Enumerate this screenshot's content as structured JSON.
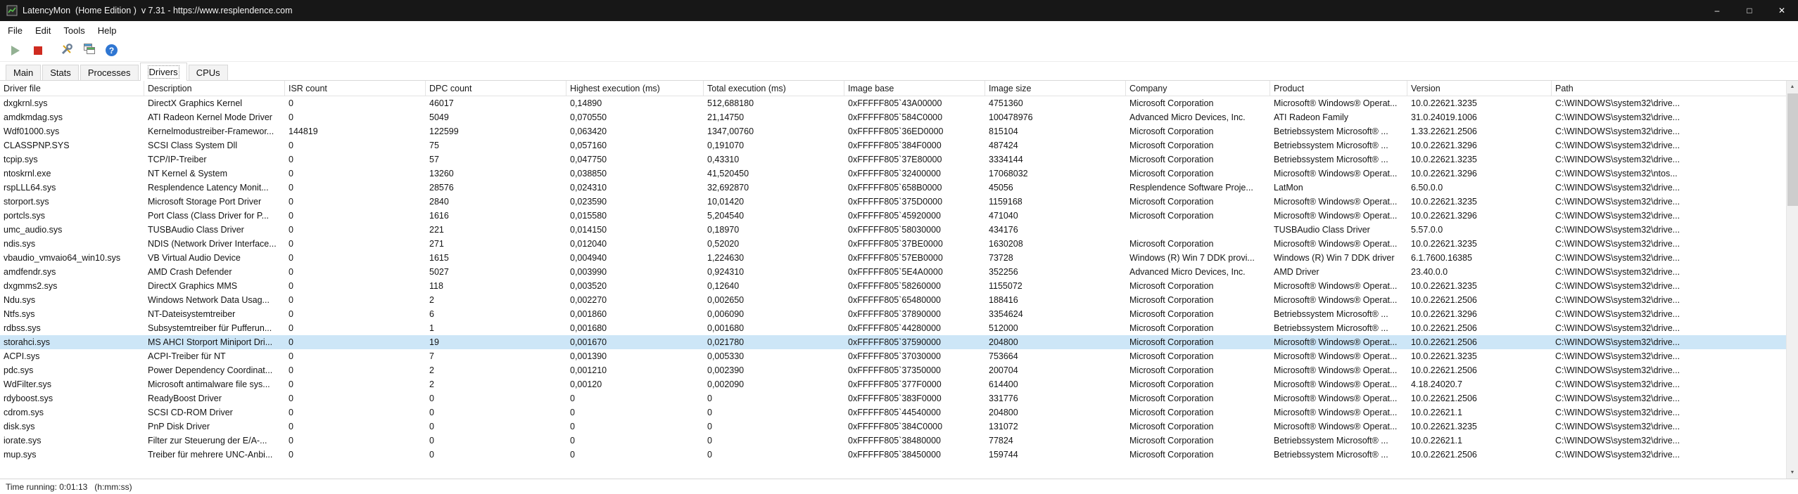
{
  "window": {
    "title": "LatencyMon  (Home Edition )  v 7.31 - https://www.resplendence.com",
    "controls": {
      "minimize": "–",
      "maximize": "□",
      "close": "✕"
    }
  },
  "menu": {
    "items": [
      "File",
      "Edit",
      "Tools",
      "Help"
    ]
  },
  "toolbar": {
    "icons": [
      "play-icon",
      "stop-icon",
      "tools-icon",
      "report-window-icon",
      "help-icon"
    ],
    "help_glyph": "?"
  },
  "tabs": {
    "items": [
      "Main",
      "Stats",
      "Processes",
      "Drivers",
      "CPUs"
    ],
    "active": "Drivers"
  },
  "table": {
    "columns": [
      "Driver file",
      "Description",
      "ISR count",
      "DPC count",
      "Highest execution (ms)",
      "Total execution (ms)",
      "Image base",
      "Image size",
      "Company",
      "Product",
      "Version",
      "Path"
    ],
    "selected_row": "storahci.sys",
    "rows": [
      [
        "dxgkrnl.sys",
        "DirectX Graphics Kernel",
        "0",
        "46017",
        "0,14890",
        "512,688180",
        "0xFFFFF805`43A00000",
        "4751360",
        "Microsoft Corporation",
        "Microsoft® Windows® Operat...",
        "10.0.22621.3235",
        "C:\\WINDOWS\\system32\\drive..."
      ],
      [
        "amdkmdag.sys",
        "ATI Radeon Kernel Mode Driver",
        "0",
        "5049",
        "0,070550",
        "21,14750",
        "0xFFFFF805`584C0000",
        "100478976",
        "Advanced Micro Devices, Inc.",
        "ATI Radeon Family",
        "31.0.24019.1006",
        "C:\\WINDOWS\\system32\\drive..."
      ],
      [
        "Wdf01000.sys",
        "Kernelmodustreiber-Framewor...",
        "144819",
        "122599",
        "0,063420",
        "1347,00760",
        "0xFFFFF805`36ED0000",
        "815104",
        "Microsoft Corporation",
        "Betriebssystem Microsoft® ...",
        "1.33.22621.2506",
        "C:\\WINDOWS\\system32\\drive..."
      ],
      [
        "CLASSPNP.SYS",
        "SCSI Class System Dll",
        "0",
        "75",
        "0,057160",
        "0,191070",
        "0xFFFFF805`384F0000",
        "487424",
        "Microsoft Corporation",
        "Betriebssystem Microsoft® ...",
        "10.0.22621.3296",
        "C:\\WINDOWS\\system32\\drive..."
      ],
      [
        "tcpip.sys",
        "TCP/IP-Treiber",
        "0",
        "57",
        "0,047750",
        "0,43310",
        "0xFFFFF805`37E80000",
        "3334144",
        "Microsoft Corporation",
        "Betriebssystem Microsoft® ...",
        "10.0.22621.3235",
        "C:\\WINDOWS\\system32\\drive..."
      ],
      [
        "ntoskrnl.exe",
        "NT Kernel & System",
        "0",
        "13260",
        "0,038850",
        "41,520450",
        "0xFFFFF805`32400000",
        "17068032",
        "Microsoft Corporation",
        "Microsoft® Windows® Operat...",
        "10.0.22621.3296",
        "C:\\WINDOWS\\system32\\ntos..."
      ],
      [
        "rspLLL64.sys",
        "Resplendence Latency Monit...",
        "0",
        "28576",
        "0,024310",
        "32,692870",
        "0xFFFFF805`658B0000",
        "45056",
        "Resplendence Software Proje...",
        "LatMon",
        "6.50.0.0",
        "C:\\WINDOWS\\system32\\drive..."
      ],
      [
        "storport.sys",
        "Microsoft Storage Port Driver",
        "0",
        "2840",
        "0,023590",
        "10,01420",
        "0xFFFFF805`375D0000",
        "1159168",
        "Microsoft Corporation",
        "Microsoft® Windows® Operat...",
        "10.0.22621.3235",
        "C:\\WINDOWS\\system32\\drive..."
      ],
      [
        "portcls.sys",
        "Port Class (Class Driver for P...",
        "0",
        "1616",
        "0,015580",
        "5,204540",
        "0xFFFFF805`45920000",
        "471040",
        "Microsoft Corporation",
        "Microsoft® Windows® Operat...",
        "10.0.22621.3296",
        "C:\\WINDOWS\\system32\\drive..."
      ],
      [
        "umc_audio.sys",
        "TUSBAudio Class Driver",
        "0",
        "221",
        "0,014150",
        "0,18970",
        "0xFFFFF805`58030000",
        "434176",
        "",
        "TUSBAudio Class Driver",
        "5.57.0.0",
        "C:\\WINDOWS\\system32\\drive..."
      ],
      [
        "ndis.sys",
        "NDIS (Network Driver Interface...",
        "0",
        "271",
        "0,012040",
        "0,52020",
        "0xFFFFF805`37BE0000",
        "1630208",
        "Microsoft Corporation",
        "Microsoft® Windows® Operat...",
        "10.0.22621.3235",
        "C:\\WINDOWS\\system32\\drive..."
      ],
      [
        "vbaudio_vmvaio64_win10.sys",
        "VB Virtual Audio Device",
        "0",
        "1615",
        "0,004940",
        "1,224630",
        "0xFFFFF805`57EB0000",
        "73728",
        "Windows (R) Win 7 DDK provi...",
        "Windows (R) Win 7 DDK driver",
        "6.1.7600.16385",
        "C:\\WINDOWS\\system32\\drive..."
      ],
      [
        "amdfendr.sys",
        "AMD Crash Defender",
        "0",
        "5027",
        "0,003990",
        "0,924310",
        "0xFFFFF805`5E4A0000",
        "352256",
        "Advanced Micro Devices, Inc.",
        "AMD Driver",
        "23.40.0.0",
        "C:\\WINDOWS\\system32\\drive..."
      ],
      [
        "dxgmms2.sys",
        "DirectX Graphics MMS",
        "0",
        "118",
        "0,003520",
        "0,12640",
        "0xFFFFF805`58260000",
        "1155072",
        "Microsoft Corporation",
        "Microsoft® Windows® Operat...",
        "10.0.22621.3235",
        "C:\\WINDOWS\\system32\\drive..."
      ],
      [
        "Ndu.sys",
        "Windows Network Data Usag...",
        "0",
        "2",
        "0,002270",
        "0,002650",
        "0xFFFFF805`65480000",
        "188416",
        "Microsoft Corporation",
        "Microsoft® Windows® Operat...",
        "10.0.22621.2506",
        "C:\\WINDOWS\\system32\\drive..."
      ],
      [
        "Ntfs.sys",
        "NT-Dateisystemtreiber",
        "0",
        "6",
        "0,001860",
        "0,006090",
        "0xFFFFF805`37890000",
        "3354624",
        "Microsoft Corporation",
        "Betriebssystem Microsoft® ...",
        "10.0.22621.3296",
        "C:\\WINDOWS\\system32\\drive..."
      ],
      [
        "rdbss.sys",
        "Subsystemtreiber für Pufferun...",
        "0",
        "1",
        "0,001680",
        "0,001680",
        "0xFFFFF805`44280000",
        "512000",
        "Microsoft Corporation",
        "Betriebssystem Microsoft® ...",
        "10.0.22621.2506",
        "C:\\WINDOWS\\system32\\drive..."
      ],
      [
        "storahci.sys",
        "MS AHCI Storport Miniport Dri...",
        "0",
        "19",
        "0,001670",
        "0,021780",
        "0xFFFFF805`37590000",
        "204800",
        "Microsoft Corporation",
        "Microsoft® Windows® Operat...",
        "10.0.22621.2506",
        "C:\\WINDOWS\\system32\\drive..."
      ],
      [
        "ACPI.sys",
        "ACPI-Treiber für NT",
        "0",
        "7",
        "0,001390",
        "0,005330",
        "0xFFFFF805`37030000",
        "753664",
        "Microsoft Corporation",
        "Microsoft® Windows® Operat...",
        "10.0.22621.3235",
        "C:\\WINDOWS\\system32\\drive..."
      ],
      [
        "pdc.sys",
        "Power Dependency Coordinat...",
        "0",
        "2",
        "0,001210",
        "0,002390",
        "0xFFFFF805`37350000",
        "200704",
        "Microsoft Corporation",
        "Microsoft® Windows® Operat...",
        "10.0.22621.2506",
        "C:\\WINDOWS\\system32\\drive..."
      ],
      [
        "WdFilter.sys",
        "Microsoft antimalware file sys...",
        "0",
        "2",
        "0,00120",
        "0,002090",
        "0xFFFFF805`377F0000",
        "614400",
        "Microsoft Corporation",
        "Microsoft® Windows® Operat...",
        "4.18.24020.7",
        "C:\\WINDOWS\\system32\\drive..."
      ],
      [
        "rdyboost.sys",
        "ReadyBoost Driver",
        "0",
        "0",
        "0",
        "0",
        "0xFFFFF805`383F0000",
        "331776",
        "Microsoft Corporation",
        "Microsoft® Windows® Operat...",
        "10.0.22621.2506",
        "C:\\WINDOWS\\system32\\drive..."
      ],
      [
        "cdrom.sys",
        "SCSI CD-ROM Driver",
        "0",
        "0",
        "0",
        "0",
        "0xFFFFF805`44540000",
        "204800",
        "Microsoft Corporation",
        "Microsoft® Windows® Operat...",
        "10.0.22621.1",
        "C:\\WINDOWS\\system32\\drive..."
      ],
      [
        "disk.sys",
        "PnP Disk Driver",
        "0",
        "0",
        "0",
        "0",
        "0xFFFFF805`384C0000",
        "131072",
        "Microsoft Corporation",
        "Microsoft® Windows® Operat...",
        "10.0.22621.3235",
        "C:\\WINDOWS\\system32\\drive..."
      ],
      [
        "iorate.sys",
        "Filter zur Steuerung der E/A-...",
        "0",
        "0",
        "0",
        "0",
        "0xFFFFF805`38480000",
        "77824",
        "Microsoft Corporation",
        "Betriebssystem Microsoft® ...",
        "10.0.22621.1",
        "C:\\WINDOWS\\system32\\drive..."
      ],
      [
        "mup.sys",
        "Treiber für mehrere UNC-Anbi...",
        "0",
        "0",
        "0",
        "0",
        "0xFFFFF805`38450000",
        "159744",
        "Microsoft Corporation",
        "Betriebssystem Microsoft® ...",
        "10.0.22621.2506",
        "C:\\WINDOWS\\system32\\drive..."
      ]
    ]
  },
  "statusbar": {
    "text": "Time running: 0:01:13   (h:mm:ss)"
  },
  "colors": {
    "titlebar": "#171717",
    "selection": "#cde6f7",
    "stop_red": "#cf2b20",
    "help_blue": "#2f76d2"
  }
}
